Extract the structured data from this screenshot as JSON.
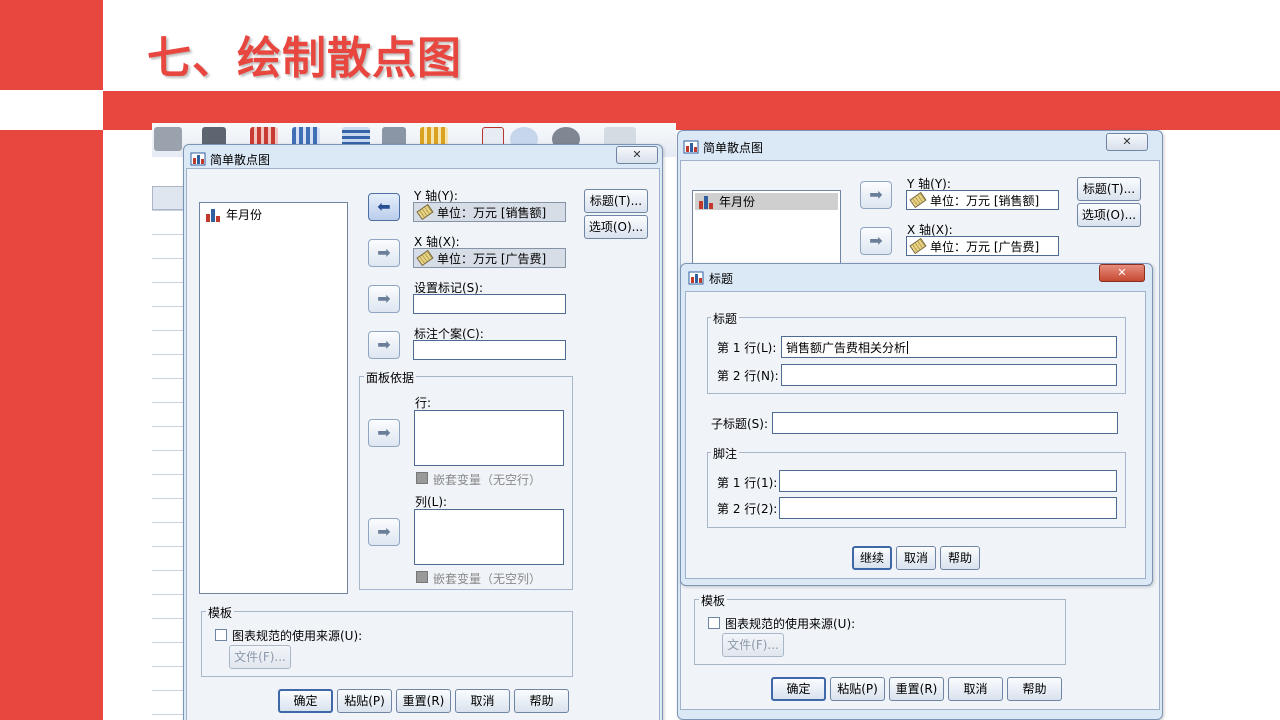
{
  "slide": {
    "title": "七、绘制散点图"
  },
  "dialog_left": {
    "title": "简单散点图",
    "variables": [
      "年月份"
    ],
    "y_axis": {
      "label": "Y 轴(Y):",
      "value": "单位：万元 [销售额]"
    },
    "x_axis": {
      "label": "X 轴(X):",
      "value": "单位：万元 [广告费]"
    },
    "set_markers_label": "设置标记(S):",
    "label_cases_label": "标注个案(C):",
    "panel_group_title": "面板依据",
    "rows_label": "行:",
    "nest_rows_label": "嵌套变量（无空行）",
    "cols_label": "列(L):",
    "nest_cols_label": "嵌套变量（无空列）",
    "template_group_title": "模板",
    "use_chart_spec_label": "图表规范的使用来源(U):",
    "file_button": "文件(F)...",
    "titles_button": "标题(T)...",
    "options_button": "选项(O)...",
    "buttons": {
      "ok": "确定",
      "paste": "粘贴(P)",
      "reset": "重置(R)",
      "cancel": "取消",
      "help": "帮助"
    }
  },
  "dialog_right": {
    "title": "简单散点图",
    "variables": [
      "年月份"
    ],
    "y_axis": {
      "label": "Y 轴(Y):",
      "value": "单位：万元 [销售额]"
    },
    "x_axis": {
      "label": "X 轴(X):",
      "value": "单位：万元 [广告费]"
    },
    "titles_button": "标题(T)...",
    "options_button": "选项(O)...",
    "template_group_title": "模板",
    "use_chart_spec_label": "图表规范的使用来源(U):",
    "file_button": "文件(F)...",
    "buttons": {
      "ok": "确定",
      "paste": "粘贴(P)",
      "reset": "重置(R)",
      "cancel": "取消",
      "help": "帮助"
    }
  },
  "titles_dialog": {
    "title": "标题",
    "title_group": "标题",
    "line1_label": "第 1 行(L):",
    "line1_value": "销售额广告费相关分析",
    "line2_label": "第 2 行(N):",
    "line2_value": "",
    "subtitle_label": "子标题(S):",
    "subtitle_value": "",
    "footnote_group": "脚注",
    "fn_line1_label": "第 1 行(1):",
    "fn_line2_label": "第 2 行(2):",
    "buttons": {
      "continue": "继续",
      "cancel": "取消",
      "help": "帮助"
    }
  },
  "colors": {
    "accent_red": "#e8473f",
    "dialog_bg": "#f0f4f9",
    "frame_blue": "#dbe8f6"
  }
}
